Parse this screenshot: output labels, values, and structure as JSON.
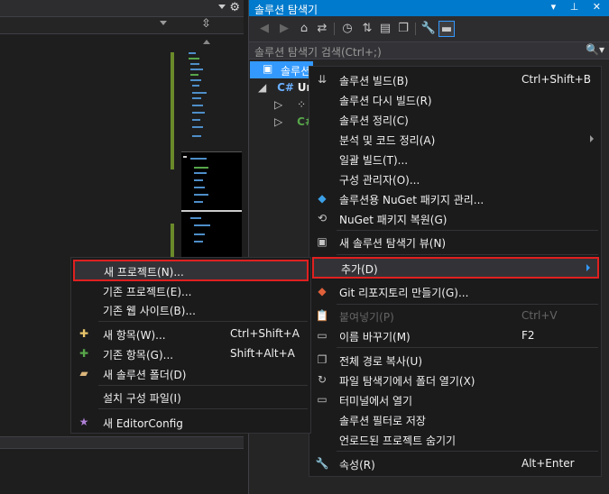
{
  "editor": {
    "splitter_icon": "split-icon",
    "gear_icon": "gear-icon"
  },
  "solution_explorer": {
    "title": "솔루션 탐색기",
    "title_buttons": "▾ ⊥ ✕",
    "search_placeholder": "솔루션 탐색기 검색(Ctrl+;)",
    "search_icon": "🔍▾",
    "tree": {
      "root_label": "솔루션",
      "project_prefix": "Ur",
      "items": [
        "",
        "C#"
      ]
    }
  },
  "context_menu": {
    "items": [
      {
        "label": "솔루션 빌드(B)",
        "shortcut": "Ctrl+Shift+B",
        "icon": "build-icon",
        "glyph": "⇊"
      },
      {
        "label": "솔루션 다시 빌드(R)",
        "shortcut": "",
        "icon": "",
        "glyph": ""
      },
      {
        "label": "솔루션 정리(C)",
        "shortcut": "",
        "icon": "",
        "glyph": ""
      },
      {
        "label": "분석 및 코드 정리(A)",
        "shortcut": "",
        "icon": "",
        "glyph": ""
      },
      {
        "label": "일괄 빌드(T)...",
        "shortcut": "",
        "icon": "",
        "glyph": ""
      },
      {
        "label": "구성 관리자(O)...",
        "shortcut": "",
        "icon": "",
        "glyph": ""
      },
      {
        "label": "솔루션용 NuGet 패키지 관리...",
        "shortcut": "",
        "icon": "nuget-icon",
        "glyph": "◆"
      },
      {
        "label": "NuGet 패키지 복원(G)",
        "shortcut": "",
        "icon": "restore-icon",
        "glyph": "⟲"
      },
      {
        "label": "새 솔루션 탐색기 뷰(N)",
        "shortcut": "",
        "icon": "new-view-icon",
        "glyph": "▣"
      },
      {
        "label": "추가(D)",
        "shortcut": "",
        "icon": "",
        "glyph": ""
      },
      {
        "label": "Git 리포지토리 만들기(G)...",
        "shortcut": "",
        "icon": "git-icon",
        "glyph": "◆"
      },
      {
        "label": "붙여넣기(P)",
        "shortcut": "Ctrl+V",
        "icon": "paste-icon",
        "glyph": "📋"
      },
      {
        "label": "이름 바꾸기(M)",
        "shortcut": "F2",
        "icon": "rename-icon",
        "glyph": "▭"
      },
      {
        "label": "전체 경로 복사(U)",
        "shortcut": "",
        "icon": "copy-icon",
        "glyph": "❐"
      },
      {
        "label": "파일 탐색기에서 폴더 열기(X)",
        "shortcut": "",
        "icon": "open-folder-icon",
        "glyph": "↻"
      },
      {
        "label": "터미널에서 열기",
        "shortcut": "",
        "icon": "terminal-icon",
        "glyph": "▭"
      },
      {
        "label": "솔루션 필터로 저장",
        "shortcut": "",
        "icon": "",
        "glyph": ""
      },
      {
        "label": "언로드된 프로젝트 숨기기",
        "shortcut": "",
        "icon": "",
        "glyph": ""
      },
      {
        "label": "속성(R)",
        "shortcut": "Alt+Enter",
        "icon": "wrench-icon",
        "glyph": "🔧"
      }
    ]
  },
  "submenu": {
    "items": [
      {
        "label": "새 프로젝트(N)...",
        "shortcut": "",
        "icon": "",
        "glyph": ""
      },
      {
        "label": "기존 프로젝트(E)...",
        "shortcut": "",
        "icon": "",
        "glyph": ""
      },
      {
        "label": "기존 웹 사이트(B)...",
        "shortcut": "",
        "icon": "",
        "glyph": ""
      },
      {
        "label": "새 항목(W)...",
        "shortcut": "Ctrl+Shift+A",
        "icon": "new-item-icon",
        "glyph": "✚"
      },
      {
        "label": "기존 항목(G)...",
        "shortcut": "Shift+Alt+A",
        "icon": "existing-item-icon",
        "glyph": "✚"
      },
      {
        "label": "새 솔루션 폴더(D)",
        "shortcut": "",
        "icon": "folder-icon",
        "glyph": "▰"
      },
      {
        "label": "설치 구성 파일(I)",
        "shortcut": "",
        "icon": "",
        "glyph": ""
      },
      {
        "label": "새 EditorConfig",
        "shortcut": "",
        "icon": "editorconfig-icon",
        "glyph": "★"
      }
    ]
  },
  "colors": {
    "accent": "#007acc",
    "highlight_border": "#e02020",
    "menu_bg": "#1b1b1c"
  }
}
